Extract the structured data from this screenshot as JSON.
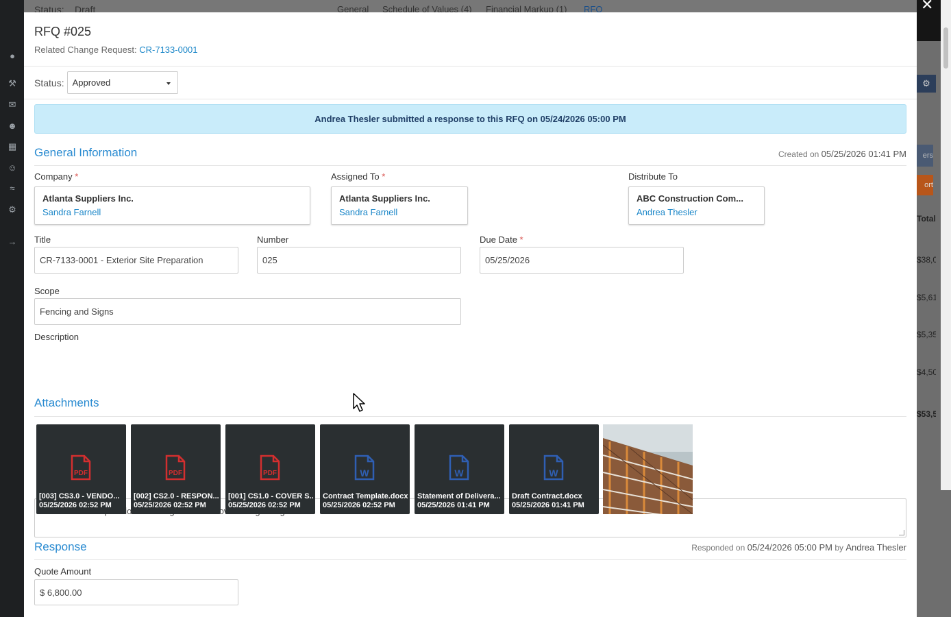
{
  "background": {
    "status_label": "Status:",
    "status_value": "Draft",
    "tabs": [
      "General",
      "Schedule of Values (4)",
      "Financial Markup (1)",
      "RFQ"
    ],
    "right_texts": [
      "ers",
      "ort",
      "Total",
      "$38,0",
      "$5,61",
      "$5,35",
      "$4,50",
      "$53,5"
    ],
    "sidebar_icons": [
      "location-icon",
      "hammer-icon",
      "mail-icon",
      "users-icon",
      "calendar-icon",
      "contacts-icon",
      "chart-icon",
      "gear-icon",
      "logout-icon"
    ]
  },
  "modal": {
    "title": "RFQ #025",
    "related_label": "Related Change Request:",
    "related_link": "CR-7133-0001",
    "status_label": "Status:",
    "status_value": "Approved",
    "alert": "Andrea Thesler submitted a response to this RFQ on 05/24/2026 05:00 PM",
    "general": {
      "heading": "General Information",
      "created_prefix": "Created on",
      "created_value": "05/25/2026 01:41 PM",
      "company_label": "Company",
      "company_name": "Atlanta Suppliers Inc.",
      "company_contact": "Sandra Farnell",
      "assigned_label": "Assigned To",
      "assigned_name": "Atlanta Suppliers Inc.",
      "assigned_contact": "Sandra Farnell",
      "distribute_label": "Distribute To",
      "distribute_name": "ABC Construction Com...",
      "distribute_contact": "Andrea Thesler",
      "title_label": "Title",
      "title_value": "CR-7133-0001 - Exterior Site Preparation",
      "number_label": "Number",
      "number_value": "025",
      "due_label": "Due Date",
      "due_value": "05/25/2026",
      "scope_label": "Scope",
      "scope_value": "Fencing and Signs",
      "description_label": "Description",
      "description_value": "Exterior Site Preparation including debris removal and grading.",
      "required_mark": "*"
    },
    "attachments": {
      "heading": "Attachments",
      "files": [
        {
          "name": "[003] CS3.0 - VENDO...",
          "date": "05/25/2026 02:52 PM",
          "type": "pdf"
        },
        {
          "name": "[002] CS2.0 - RESPON...",
          "date": "05/25/2026 02:52 PM",
          "type": "pdf"
        },
        {
          "name": "[001] CS1.0 - COVER S...",
          "date": "05/25/2026 02:52 PM",
          "type": "pdf"
        },
        {
          "name": "Contract Template.docx",
          "date": "05/25/2026 02:52 PM",
          "type": "word"
        },
        {
          "name": "Statement of Delivera...",
          "date": "05/25/2026 01:41 PM",
          "type": "word"
        },
        {
          "name": "Draft Contract.docx",
          "date": "05/25/2026 01:41 PM",
          "type": "word"
        }
      ]
    },
    "response": {
      "heading": "Response",
      "responded_prefix": "Responded on",
      "responded_value": "05/24/2026 05:00 PM",
      "by_prefix": "by",
      "by_value": "Andrea Thesler",
      "quote_label": "Quote Amount",
      "quote_value": "$ 6,800.00"
    }
  },
  "colors": {
    "accent": "#2a8bd1",
    "link": "#1a86c8",
    "alert_bg": "#c9ecfa",
    "pdf": "#d32f2f",
    "word": "#2f5fb3"
  }
}
